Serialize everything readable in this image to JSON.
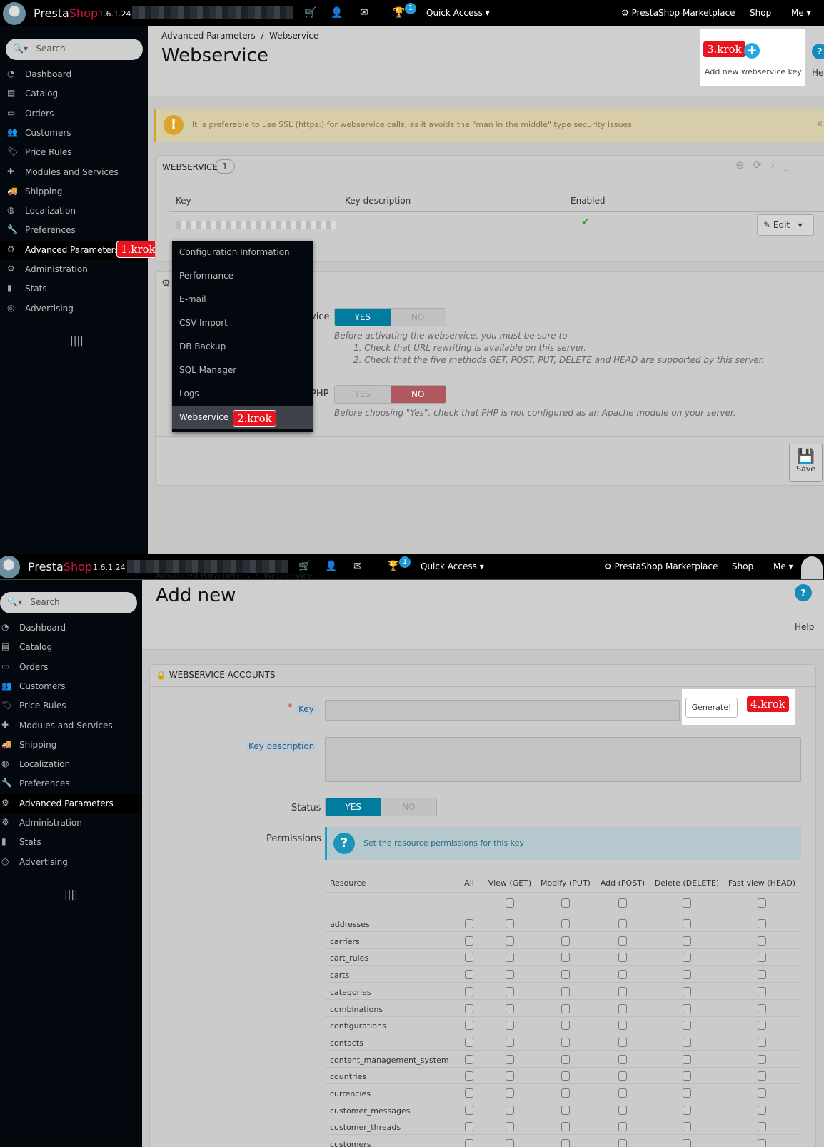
{
  "header": {
    "brand_a": "Presta",
    "brand_b": "Shop",
    "version": "1.6.1.24",
    "notifications": "1",
    "quick_access": "Quick Access",
    "marketplace": "PrestaShop Marketplace",
    "shop": "Shop",
    "me": "Me"
  },
  "sidebar": {
    "search_placeholder": "Search",
    "items": [
      "Dashboard",
      "Catalog",
      "Orders",
      "Customers",
      "Price Rules",
      "Modules and Services",
      "Shipping",
      "Localization",
      "Preferences",
      "Advanced Parameters",
      "Administration",
      "Stats",
      "Advertising"
    ],
    "icons": [
      "dashboard-icon",
      "catalog-icon",
      "orders-icon",
      "customers-icon",
      "price-rules-icon",
      "modules-icon",
      "shipping-icon",
      "localization-icon",
      "preferences-icon",
      "advanced-parameters-icon",
      "administration-icon",
      "stats-icon",
      "advertising-icon"
    ]
  },
  "screen1": {
    "breadcrumb": [
      "Advanced Parameters",
      "/",
      "Webservice"
    ],
    "title": "Webservice",
    "add_key": "Add new webservice key",
    "help": "Help",
    "steps": {
      "s1": "1.krok",
      "s2": "2.krok",
      "s3": "3.krok",
      "s4": "4.krok"
    },
    "ssl_warning": "It is preferable to use SSL (https:) for webservice calls, as it avoids the \"man in the middle\" type security issues.",
    "list": {
      "title": "WEBSERVICE",
      "count": "1",
      "columns": [
        "Key",
        "Key description",
        "Enabled"
      ],
      "edit": "Edit"
    },
    "submenu": [
      "Configuration Information",
      "Performance",
      "E-mail",
      "CSV Import",
      "DB Backup",
      "SQL Manager",
      "Logs",
      "Webservice"
    ],
    "options": {
      "enable_label_tail": "vice",
      "yes": "YES",
      "no": "NO",
      "enable_help": "Before activating the webservice, you must be sure to",
      "enable_help_1": "1. Check that URL rewriting is available on this server.",
      "enable_help_2": "2. Check that the five methods GET, POST, PUT, DELETE and HEAD are supported by this server.",
      "cgi_label_tail": "PHP",
      "cgi_help": "Before choosing \"Yes\", check that PHP is not configured as an Apache module on your server.",
      "save": "Save"
    }
  },
  "screen2": {
    "breadcrumb": [
      "Advanced Parameters",
      "/",
      "Webservice"
    ],
    "title": "Add new",
    "help": "Help",
    "panel_title": "WEBSERVICE ACCOUNTS",
    "key_label": "Key",
    "key_value": "",
    "generate": "Generate!",
    "desc_label": "Key description",
    "desc_value": "",
    "status_label": "Status",
    "yes": "YES",
    "no": "NO",
    "perm_label": "Permissions",
    "perm_info": "Set the resource permissions for this key",
    "columns": [
      "Resource",
      "All",
      "View (GET)",
      "Modify (PUT)",
      "Add (POST)",
      "Delete (DELETE)",
      "Fast view (HEAD)"
    ],
    "resources": [
      "addresses",
      "carriers",
      "cart_rules",
      "carts",
      "categories",
      "combinations",
      "configurations",
      "contacts",
      "content_management_system",
      "countries",
      "currencies",
      "customer_messages",
      "customer_threads",
      "customers"
    ]
  },
  "colors": {
    "accent": "#017c9f",
    "danger": "#b05860",
    "brand": "#d0143f",
    "step_badge": "#e8141f"
  }
}
